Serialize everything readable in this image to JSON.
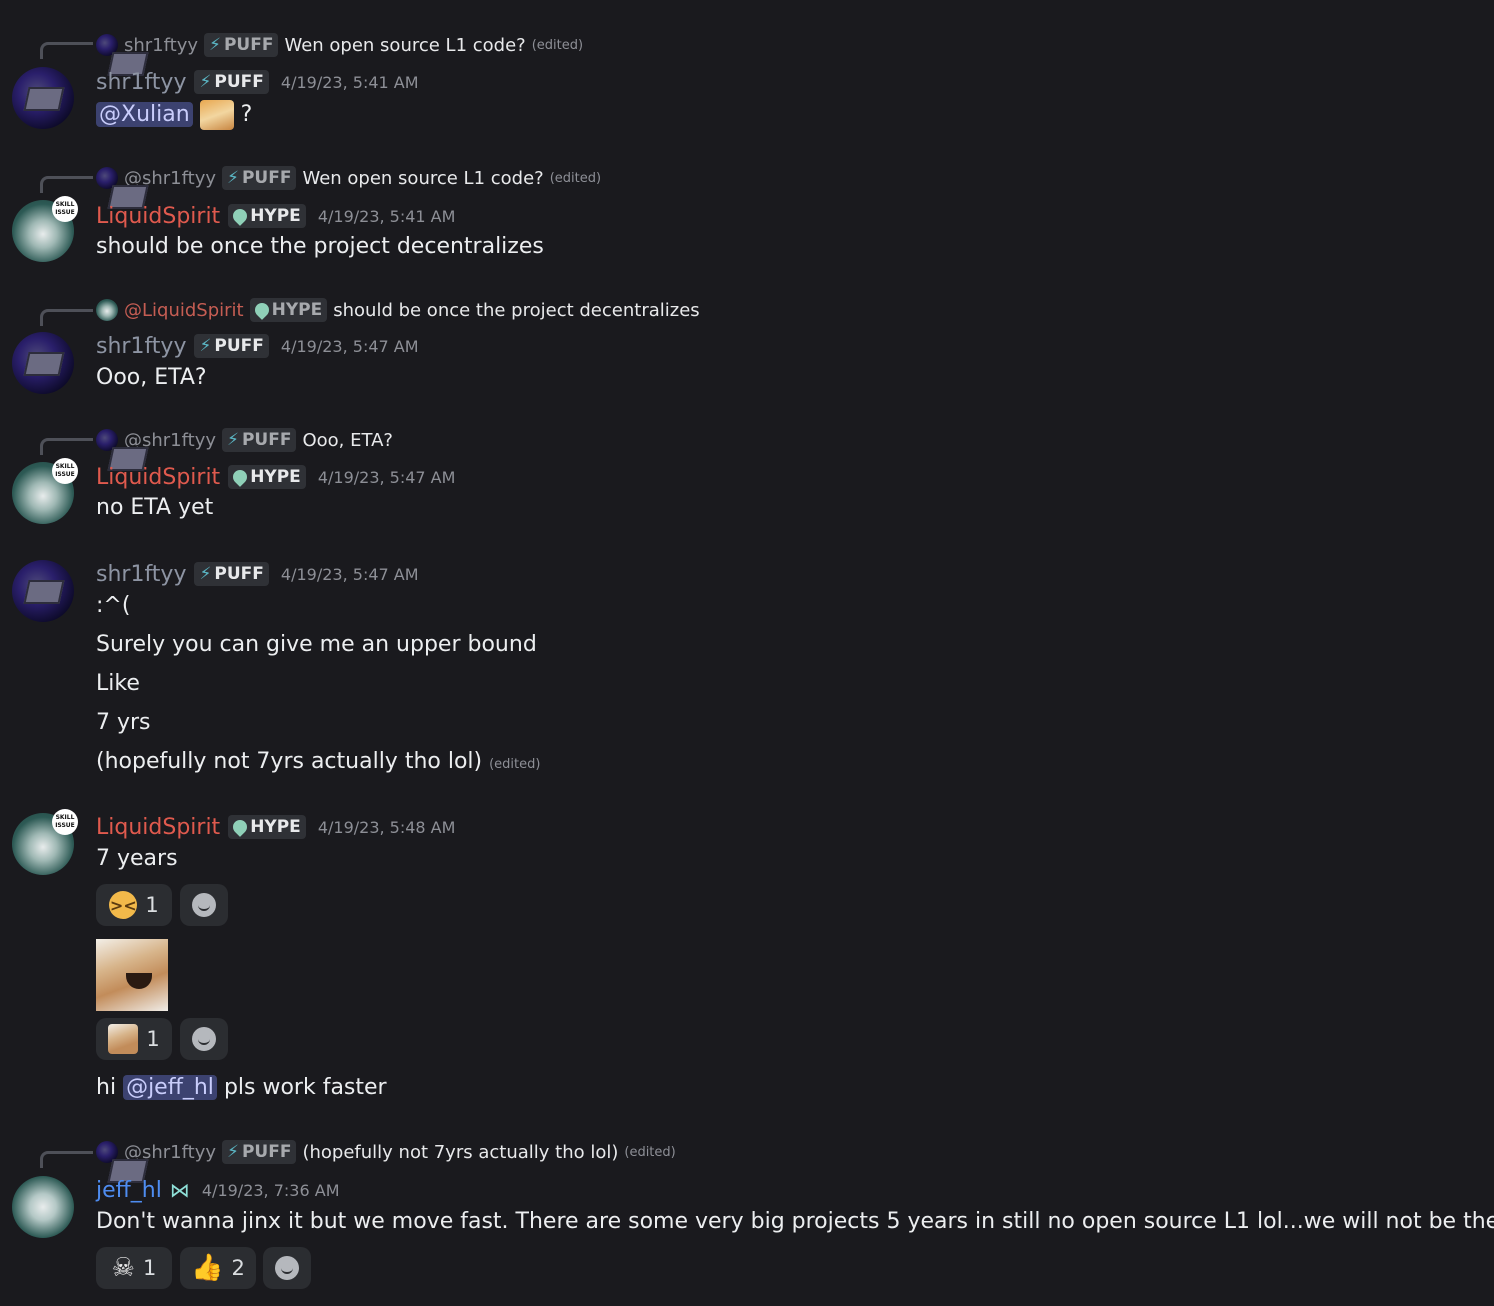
{
  "messages": [
    {
      "reply": {
        "name": "shr1ftyy",
        "tag": "PUFF",
        "text": "Wen open source L1 code?",
        "edited": "(edited)"
      },
      "author": "shr1ftyy",
      "tag": "PUFF",
      "time": "4/19/23, 5:41 AM",
      "mention": "@Xulian",
      "after_mention": "?"
    },
    {
      "reply": {
        "name": "@shr1ftyy",
        "tag": "PUFF",
        "text": "Wen open source L1 code?",
        "edited": "(edited)"
      },
      "author": "LiquidSpirit",
      "tag": "HYPE",
      "time": "4/19/23, 5:41 AM",
      "lines": [
        "should be once the project decentralizes"
      ]
    },
    {
      "reply": {
        "name": "@LiquidSpirit",
        "tag": "HYPE",
        "text": "should be once the project decentralizes"
      },
      "author": "shr1ftyy",
      "tag": "PUFF",
      "time": "4/19/23, 5:47 AM",
      "lines": [
        "Ooo, ETA?"
      ]
    },
    {
      "reply": {
        "name": "@shr1ftyy",
        "tag": "PUFF",
        "text": "Ooo, ETA?"
      },
      "author": "LiquidSpirit",
      "tag": "HYPE",
      "time": "4/19/23, 5:47 AM",
      "lines": [
        "no ETA yet"
      ]
    },
    {
      "author": "shr1ftyy",
      "tag": "PUFF",
      "time": "4/19/23, 5:47 AM",
      "lines": [
        ":^(",
        "Surely you can give me an upper bound",
        "Like",
        "7 yrs",
        "(hopefully not 7yrs actually tho lol)"
      ],
      "edited": "(edited)"
    },
    {
      "author": "LiquidSpirit",
      "tag": "HYPE",
      "time": "4/19/23, 5:48 AM",
      "lines": [
        "7 years"
      ],
      "reactions": [
        {
          "emoji": "weary-face",
          "count": "1"
        }
      ],
      "sticker_reactions": [
        {
          "emoji": "dog-sticker",
          "count": "1"
        }
      ],
      "followup": {
        "prefix": "hi",
        "mention": "@jeff_hl",
        "suffix": "pls work faster"
      }
    },
    {
      "reply": {
        "name": "@shr1ftyy",
        "tag": "PUFF",
        "text": "(hopefully not 7yrs actually tho lol)",
        "edited": "(edited)"
      },
      "author": "jeff_hl",
      "time": "4/19/23, 7:36 AM",
      "lines": [
        "Don't wanna jinx it but we move fast. There are some very big projects 5 years in still no open source L1 lol...we will not be them."
      ],
      "reactions": [
        {
          "emoji": "skull",
          "count": "1"
        },
        {
          "emoji": "thumbs-up",
          "count": "2"
        }
      ]
    }
  ],
  "colors": {
    "background": "#1a1a1e",
    "shr1ftyy": "#8d94a3",
    "LiquidSpirit": "#e05a4e",
    "jeff_hl": "#4e8cf0",
    "mention_bg": "#3c4270"
  }
}
